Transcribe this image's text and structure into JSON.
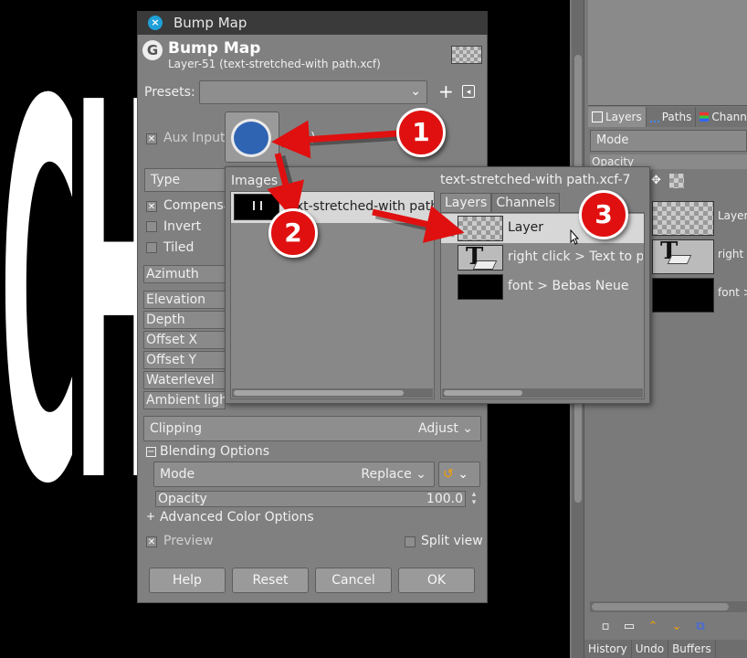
{
  "canvas": {
    "text": "CH"
  },
  "dialog": {
    "window_title": "Bump Map",
    "heading": "Bump Map",
    "subtitle": "Layer-51 (text-stretched-with path.xcf)",
    "presets_label": "Presets:",
    "aux_input_label": "Aux Input",
    "aux_paren": ")",
    "type_label": "Type",
    "compensate_label": "Compensa",
    "invert_label": "Invert",
    "tiled_label": "Tiled",
    "azimuth_label": "Azimuth",
    "elevation_label": "Elevation",
    "depth_label": "Depth",
    "offset_x_label": "Offset X",
    "offset_y_label": "Offset Y",
    "waterlevel_label": "Waterlevel",
    "ambient_label": "Ambient ligh",
    "clipping_label": "Clipping",
    "clipping_value": "Adjust",
    "blending_label": "Blending Options",
    "mode_label": "Mode",
    "mode_value": "Replace",
    "opacity_label": "Opacity",
    "opacity_value": "100.0",
    "advanced_label": "Advanced Color Options",
    "preview_label": "Preview",
    "split_view_label": "Split view",
    "buttons": {
      "help": "Help",
      "reset": "Reset",
      "cancel": "Cancel",
      "ok": "OK"
    }
  },
  "popup": {
    "images_header": "Images",
    "image_name": "text-stretched-with path.xcf",
    "doc_title": "text-stretched-with path.xcf-7",
    "tabs": {
      "layers": "Layers",
      "channels": "Channels"
    },
    "layers": [
      {
        "name": "Layer",
        "thumb": "checker"
      },
      {
        "name": "right click > Text to path",
        "thumb": "text"
      },
      {
        "name": "font > Bebas Neue",
        "thumb": "black"
      }
    ]
  },
  "dock": {
    "tabs": {
      "layers": "Layers",
      "paths": "Paths",
      "channels": "Channel"
    },
    "mode_label": "Mode",
    "opacity_label": "Opacity",
    "layers": [
      {
        "name": "Layer"
      },
      {
        "name": "right c"
      },
      {
        "name": "font >"
      }
    ],
    "bottom_tabs": {
      "history": "History",
      "undo": "Undo",
      "buffers": "Buffers"
    }
  },
  "annotations": {
    "badge1": "1",
    "badge2": "2",
    "badge3": "3"
  },
  "colors": {
    "annotation_red": "#e01010",
    "aux_swatch": "#2f64b3",
    "close_button": "#1fa0d8"
  }
}
